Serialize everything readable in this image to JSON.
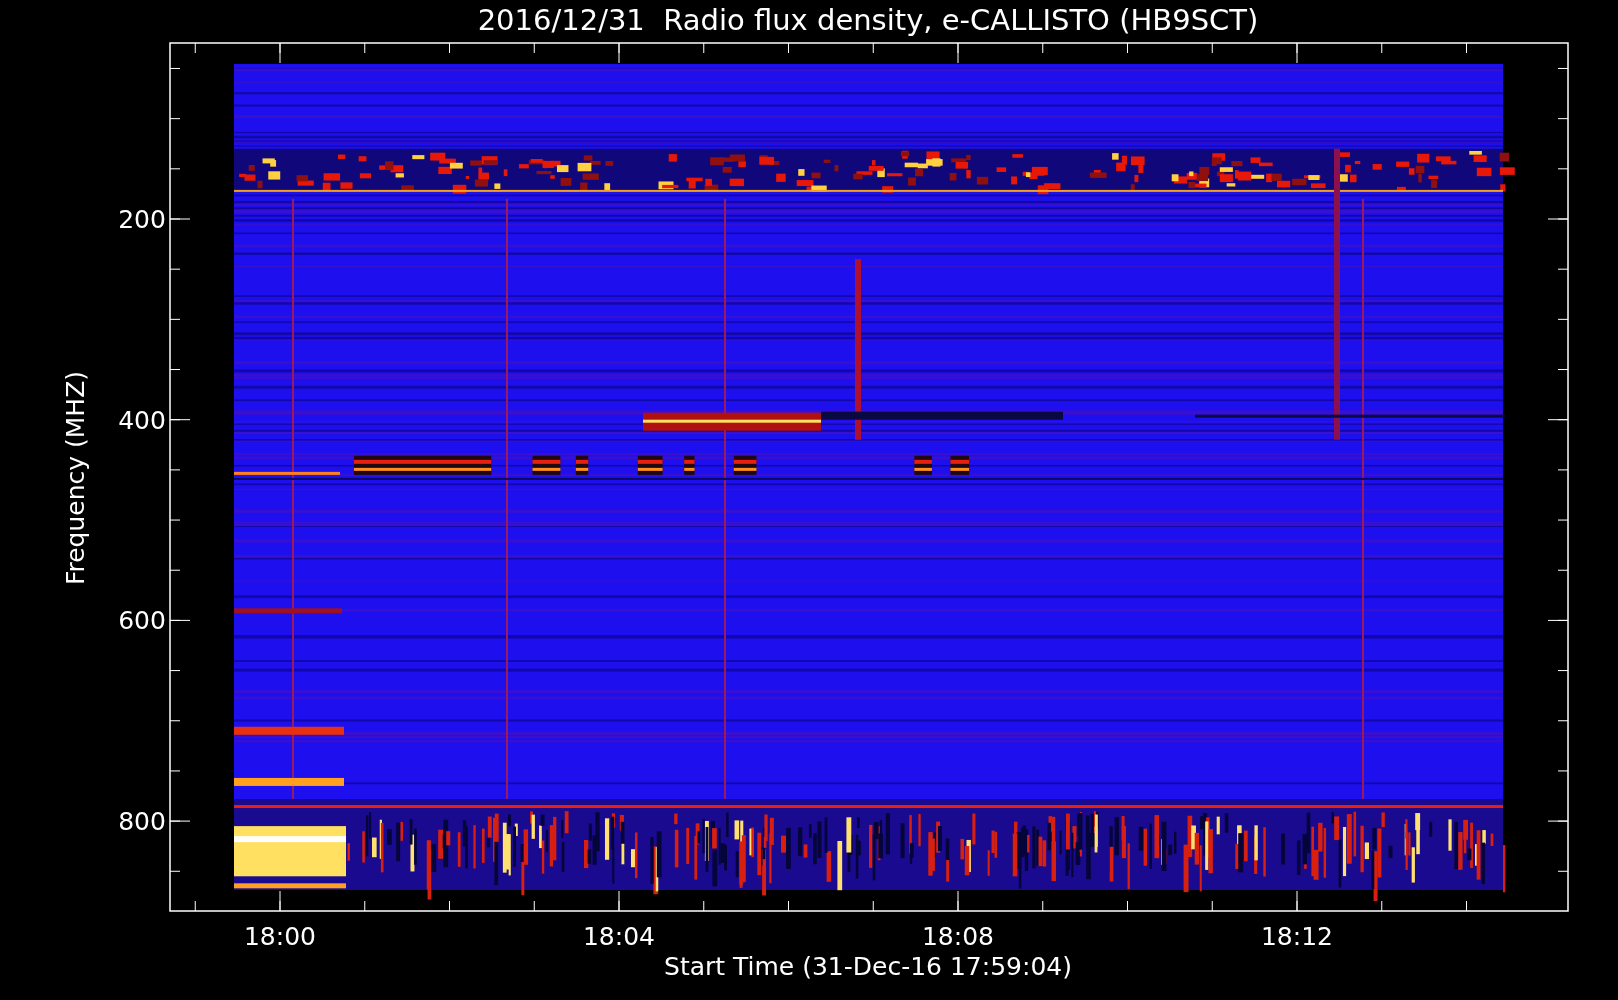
{
  "title": "2016/12/31  Radio flux density, e-CALLISTO (HB9SCT)",
  "y_axis": {
    "label": "Frequency (MHZ)",
    "ticks": [
      "200",
      "400",
      "600",
      "800"
    ]
  },
  "x_axis": {
    "label": "Start Time (31-Dec-16 17:59:04)",
    "ticks": [
      "18:00",
      "18:04",
      "18:08",
      "18:12"
    ]
  }
}
